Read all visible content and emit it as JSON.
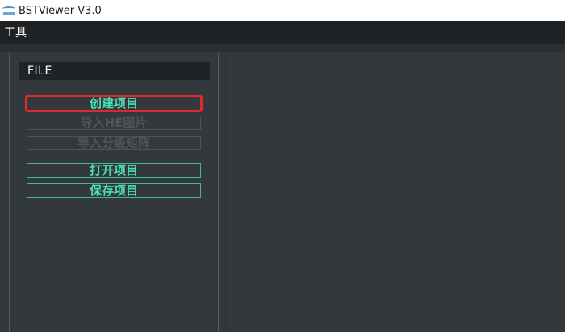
{
  "window": {
    "title": "BSTViewer V3.0",
    "icon": "app-logo-icon"
  },
  "menubar": {
    "items": [
      {
        "label": "工具"
      }
    ]
  },
  "panel": {
    "header": "FILE",
    "buttons": [
      {
        "label": "创建项目",
        "enabled": true,
        "focused": true
      },
      {
        "label": "导入HE图片",
        "enabled": false
      },
      {
        "label": "导入分级矩阵",
        "enabled": false
      },
      {
        "label": "打开项目",
        "enabled": true
      },
      {
        "label": "保存项目",
        "enabled": true
      }
    ]
  },
  "colors": {
    "accent": "#4be0b5",
    "focus_ring": "#e02a2a",
    "background": "#33383c",
    "menubar": "#1f2224"
  }
}
